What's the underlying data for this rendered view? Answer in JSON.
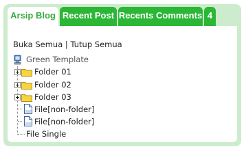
{
  "tabs": [
    {
      "label": "Arsip Blog",
      "active": true
    },
    {
      "label": "Recent Post",
      "active": false
    },
    {
      "label": "Recents Comments",
      "active": false
    },
    {
      "label": "4",
      "active": false
    }
  ],
  "toggle": {
    "expand_all": "Buka Semua",
    "separator": "|",
    "collapse_all": "Tutup Semua"
  },
  "tree": {
    "root": "Green Template",
    "folders": [
      "Folder 01",
      "Folder 02",
      "Folder 03"
    ],
    "files": [
      "File[non-folder]",
      "File[non-folder]"
    ],
    "single": "File Single"
  },
  "colors": {
    "tab_green": "#2bb636",
    "active_tab_text": "#3aaa44",
    "widget_bg": "#cdeccd",
    "folder_yellow": "#f5d640"
  }
}
